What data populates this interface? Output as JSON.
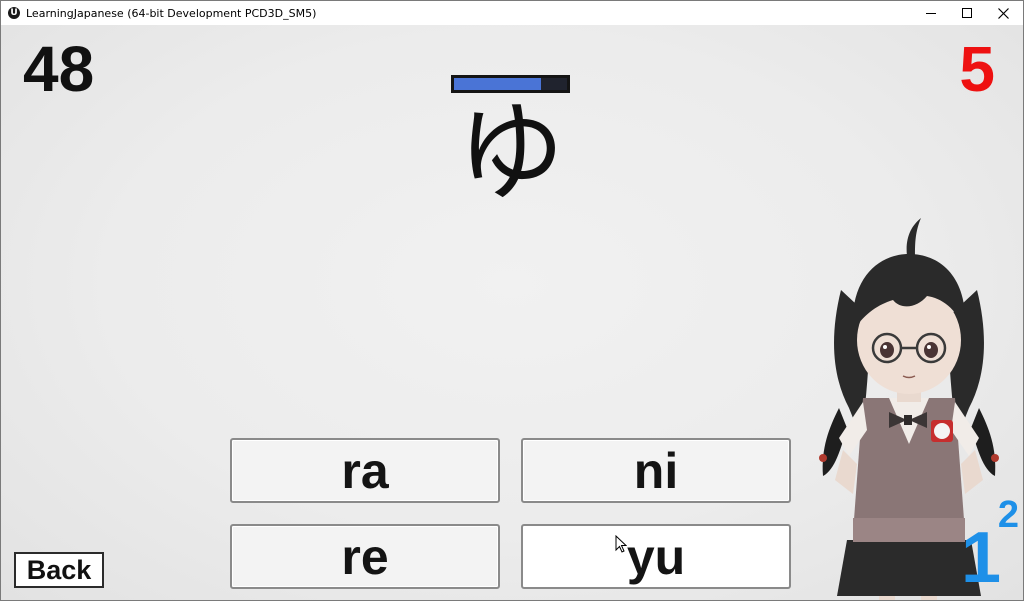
{
  "window": {
    "title": "LearningJapanese (64-bit Development PCD3D_SM5)",
    "app_icon": "U",
    "controls": [
      "minimize-icon",
      "maximize-icon",
      "close-icon"
    ]
  },
  "game": {
    "score": "48",
    "lives": "5",
    "timer_fraction": 0.77,
    "prompt_kana": "ゆ",
    "answers": [
      "ra",
      "ni",
      "re",
      "yu"
    ],
    "back_label": "Back",
    "level_major": "1",
    "level_minor": "2",
    "colors": {
      "score": "#111111",
      "lives": "#ee1111",
      "timer_fill": "#4a74d6",
      "level": "#1e90e8"
    }
  }
}
